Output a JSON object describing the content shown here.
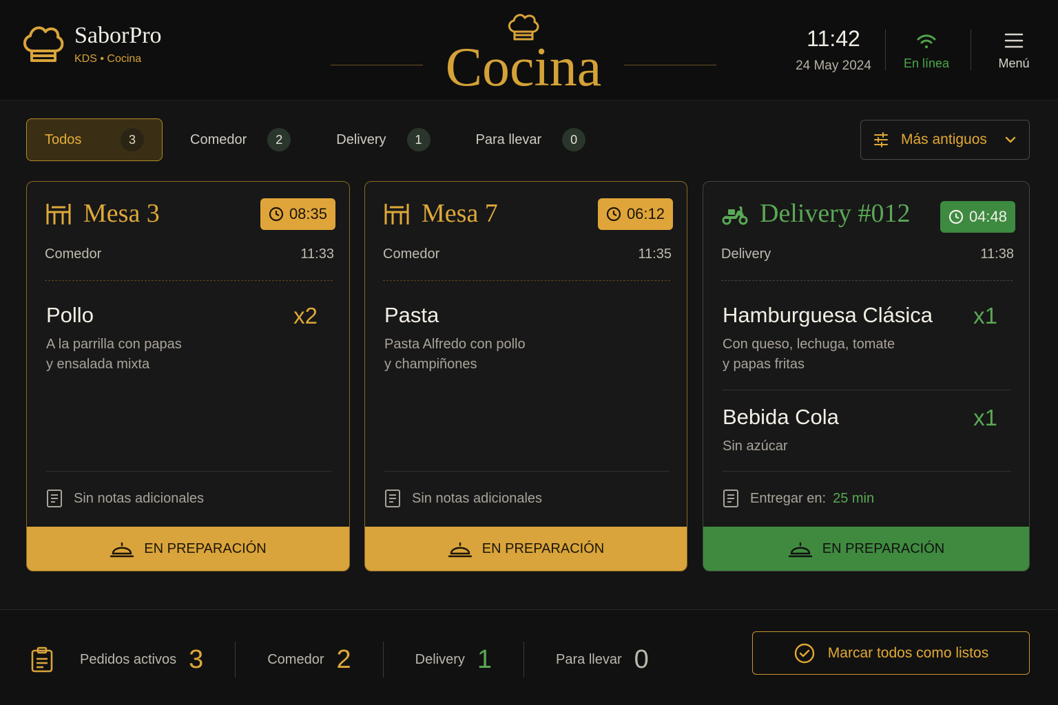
{
  "header": {
    "brand_name": "SaborPro",
    "brand_sub": "KDS • Cocina",
    "title": "Cocina",
    "time": "11:42",
    "date": "24 May 2024",
    "status": "En línea",
    "menu_label": "Menú"
  },
  "filters": [
    {
      "label": "Todos",
      "count": "3",
      "active": true
    },
    {
      "label": "Comedor",
      "count": "2"
    },
    {
      "label": "Delivery",
      "count": "1"
    },
    {
      "label": "Para llevar",
      "count": "0"
    }
  ],
  "sort": {
    "label": "Más antiguos",
    "icon": "sliders-icon"
  },
  "orders": [
    {
      "title": "Mesa 3",
      "icon": "table-icon",
      "timer": "08:35",
      "type": "Comedor",
      "time": "11:33",
      "items": [
        {
          "name": "Pollo",
          "qty": "x2",
          "desc_1": "A la parrilla con papas",
          "desc_2": "y ensalada mixta"
        }
      ],
      "notes": "Sin notas adicionales",
      "status": "EN PREPARACIÓN"
    },
    {
      "title": "Mesa 7",
      "icon": "table-icon",
      "timer": "06:12",
      "type": "Comedor",
      "time": "11:35",
      "items": [
        {
          "name": "Pasta",
          "qty": "",
          "desc_1": "Pasta Alfredo con pollo",
          "desc_2": "y champiñones"
        }
      ],
      "notes": "Sin notas adicionales",
      "status": "EN PREPARACIÓN"
    },
    {
      "title": "Delivery #012",
      "icon": "scooter-icon",
      "timer": "04:48",
      "type": "Delivery",
      "time": "11:38",
      "items": [
        {
          "name": "Hamburguesa Clásica",
          "qty": "x1",
          "desc_1": "Con queso, lechuga, tomate",
          "desc_2": "y papas fritas"
        },
        {
          "name": "Bebida Cola",
          "qty": "x1",
          "desc_1": "Sin azúcar"
        }
      ],
      "notes": "Entregar en:",
      "notes_value": "25 min",
      "status": "EN PREPARACIÓN"
    }
  ],
  "footer": {
    "active_label": "Pedidos activos",
    "active_value": "3",
    "dine_label": "Comedor",
    "dine_value": "2",
    "delivery_label": "Delivery",
    "delivery_value": "1",
    "takeaway_label": "Para llevar",
    "takeaway_value": "0",
    "mark_all": "Marcar todos como listos"
  },
  "colors": {
    "accent": "#d9a43b",
    "green": "#3f8a3f",
    "background": "#141414"
  }
}
